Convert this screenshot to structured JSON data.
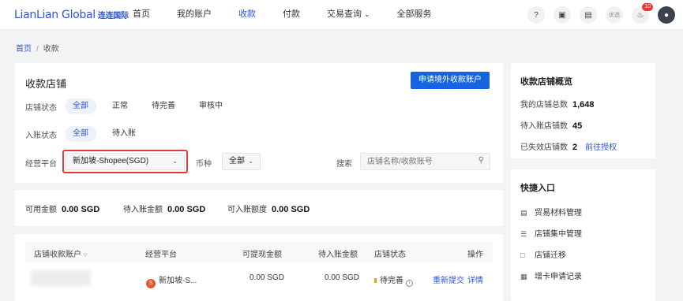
{
  "brand": {
    "logo_text": "LianLian Global",
    "logo_cn": "连连国际"
  },
  "nav": {
    "items": [
      {
        "label": "首页"
      },
      {
        "label": "我的账户"
      },
      {
        "label": "收款"
      },
      {
        "label": "付款"
      },
      {
        "label": "交易查询"
      },
      {
        "label": "全部服务"
      }
    ],
    "active": "收款"
  },
  "header_icons": {
    "youxuan": "优选",
    "notif_count": "10"
  },
  "breadcrumb": {
    "home": "首页",
    "sep": "/",
    "current": "收款"
  },
  "main": {
    "title": "收款店铺",
    "apply_button": "申请境外收款账户",
    "store_status": {
      "label": "店铺状态",
      "options": [
        "全部",
        "正常",
        "待完善",
        "审核中"
      ],
      "selected": "全部"
    },
    "entry_status": {
      "label": "入账状态",
      "options": [
        "全部",
        "待入账"
      ],
      "selected": "全部"
    },
    "platform": {
      "label": "经营平台",
      "value": "新加坡-Shopee(SGD)"
    },
    "currency": {
      "label": "币种",
      "value": "全部"
    },
    "search": {
      "label": "搜索",
      "placeholder": "店铺名称/收款账号"
    }
  },
  "balances": [
    {
      "label": "可用金额",
      "value": "0.00 SGD"
    },
    {
      "label": "待入账金额",
      "value": "0.00 SGD"
    },
    {
      "label": "可入账额度",
      "value": "0.00 SGD"
    }
  ],
  "table": {
    "headers": [
      "店铺收款账户",
      "经营平台",
      "可提现金额",
      "待入账金额",
      "店铺状态",
      "操作"
    ],
    "rows": [
      {
        "platform": "新加坡-S...",
        "platform_icon": "S",
        "withdrawable": "0.00 SGD",
        "pending": "0.00 SGD",
        "status": "待完善",
        "actions": [
          "重新提交",
          "详情"
        ]
      }
    ]
  },
  "overview": {
    "title": "收款店铺概览",
    "rows": [
      {
        "label": "我的店铺总数",
        "value": "1,648"
      },
      {
        "label": "待入账店铺数",
        "value": "45"
      },
      {
        "label": "已失效店铺数",
        "value": "2",
        "link": "前往授权"
      }
    ]
  },
  "quick": {
    "title": "快捷入口",
    "items": [
      {
        "label": "贸易材料管理",
        "icon": "book-icon"
      },
      {
        "label": "店铺集中管理",
        "icon": "layers-icon"
      },
      {
        "label": "店铺迁移",
        "icon": "store-icon"
      },
      {
        "label": "增卡申请记录",
        "icon": "document-icon"
      }
    ]
  },
  "colors": {
    "primary": "#1565e0",
    "highlight_border": "#e03a3a",
    "status_pending": "#f39c12"
  }
}
